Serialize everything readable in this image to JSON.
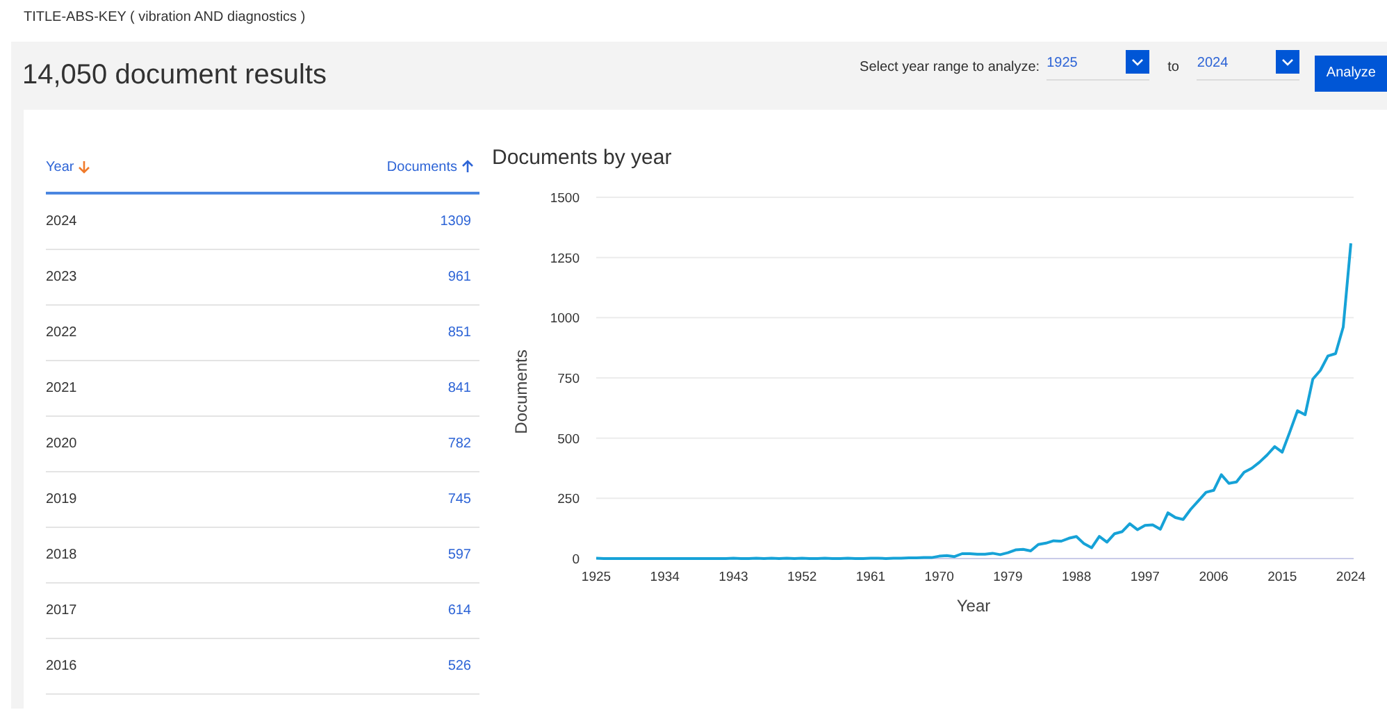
{
  "query": "TITLE-ABS-KEY ( vibration  AND diagnostics )",
  "results_title": "14,050 document results",
  "year_range": {
    "label": "Select year range to analyze:",
    "from": "1925",
    "separator": "to",
    "to": "2024",
    "button": "Analyze"
  },
  "table": {
    "columns": [
      {
        "label": "Year",
        "kind": "descending",
        "active": true
      },
      {
        "label": "Documents",
        "kind": "ascending",
        "active": false
      }
    ],
    "rows": [
      {
        "year": "2024",
        "documents": "1309"
      },
      {
        "year": "2023",
        "documents": "961"
      },
      {
        "year": "2022",
        "documents": "851"
      },
      {
        "year": "2021",
        "documents": "841"
      },
      {
        "year": "2020",
        "documents": "782"
      },
      {
        "year": "2019",
        "documents": "745"
      },
      {
        "year": "2018",
        "documents": "597"
      },
      {
        "year": "2017",
        "documents": "614"
      },
      {
        "year": "2016",
        "documents": "526"
      }
    ]
  },
  "chart": {
    "chart_data": {
      "type": "line",
      "grid": true,
      "title": "Documents by year",
      "xlabel": "Year",
      "ylabel": "Documents",
      "xlim": [
        1925,
        2024
      ],
      "ylim": [
        0,
        1500
      ],
      "xticks": [
        1925,
        1934,
        1943,
        1952,
        1961,
        1970,
        1979,
        1988,
        1997,
        2006,
        2015,
        2024
      ],
      "yticks": [
        0,
        250,
        500,
        750,
        1000,
        1250,
        1500
      ],
      "x": [
        1925,
        1926,
        1927,
        1928,
        1929,
        1930,
        1931,
        1932,
        1933,
        1934,
        1935,
        1936,
        1937,
        1938,
        1939,
        1940,
        1941,
        1942,
        1943,
        1944,
        1945,
        1946,
        1947,
        1948,
        1949,
        1950,
        1951,
        1952,
        1953,
        1954,
        1955,
        1956,
        1957,
        1958,
        1959,
        1960,
        1961,
        1962,
        1963,
        1964,
        1965,
        1966,
        1967,
        1968,
        1969,
        1970,
        1971,
        1972,
        1973,
        1974,
        1975,
        1976,
        1977,
        1978,
        1979,
        1980,
        1981,
        1982,
        1983,
        1984,
        1985,
        1986,
        1987,
        1988,
        1989,
        1990,
        1991,
        1992,
        1993,
        1994,
        1995,
        1996,
        1997,
        1998,
        1999,
        2000,
        2001,
        2002,
        2003,
        2004,
        2005,
        2006,
        2007,
        2008,
        2009,
        2010,
        2011,
        2012,
        2013,
        2014,
        2015,
        2016,
        2017,
        2018,
        2019,
        2020,
        2021,
        2022,
        2023,
        2024
      ],
      "series": [
        {
          "color": "#16a2d7",
          "values": [
            1,
            0,
            0,
            0,
            0,
            0,
            0,
            0,
            0,
            0,
            0,
            0,
            0,
            0,
            0,
            0,
            0,
            0,
            1,
            0,
            0,
            1,
            0,
            1,
            0,
            2,
            0,
            1,
            0,
            0,
            1,
            0,
            0,
            1,
            0,
            0,
            1,
            2,
            0,
            1,
            2,
            3,
            3,
            4,
            4,
            10,
            12,
            8,
            20,
            20,
            18,
            18,
            22,
            16,
            24,
            36,
            38,
            32,
            58,
            64,
            74,
            72,
            84,
            92,
            62,
            45,
            92,
            68,
            103,
            112,
            145,
            120,
            138,
            140,
            122,
            190,
            170,
            162,
            205,
            240,
            275,
            283,
            348,
            312,
            318,
            358,
            375,
            400,
            430,
            465,
            442,
            526,
            614,
            597,
            745,
            782,
            841,
            851,
            961,
            1309
          ]
        }
      ]
    }
  }
}
